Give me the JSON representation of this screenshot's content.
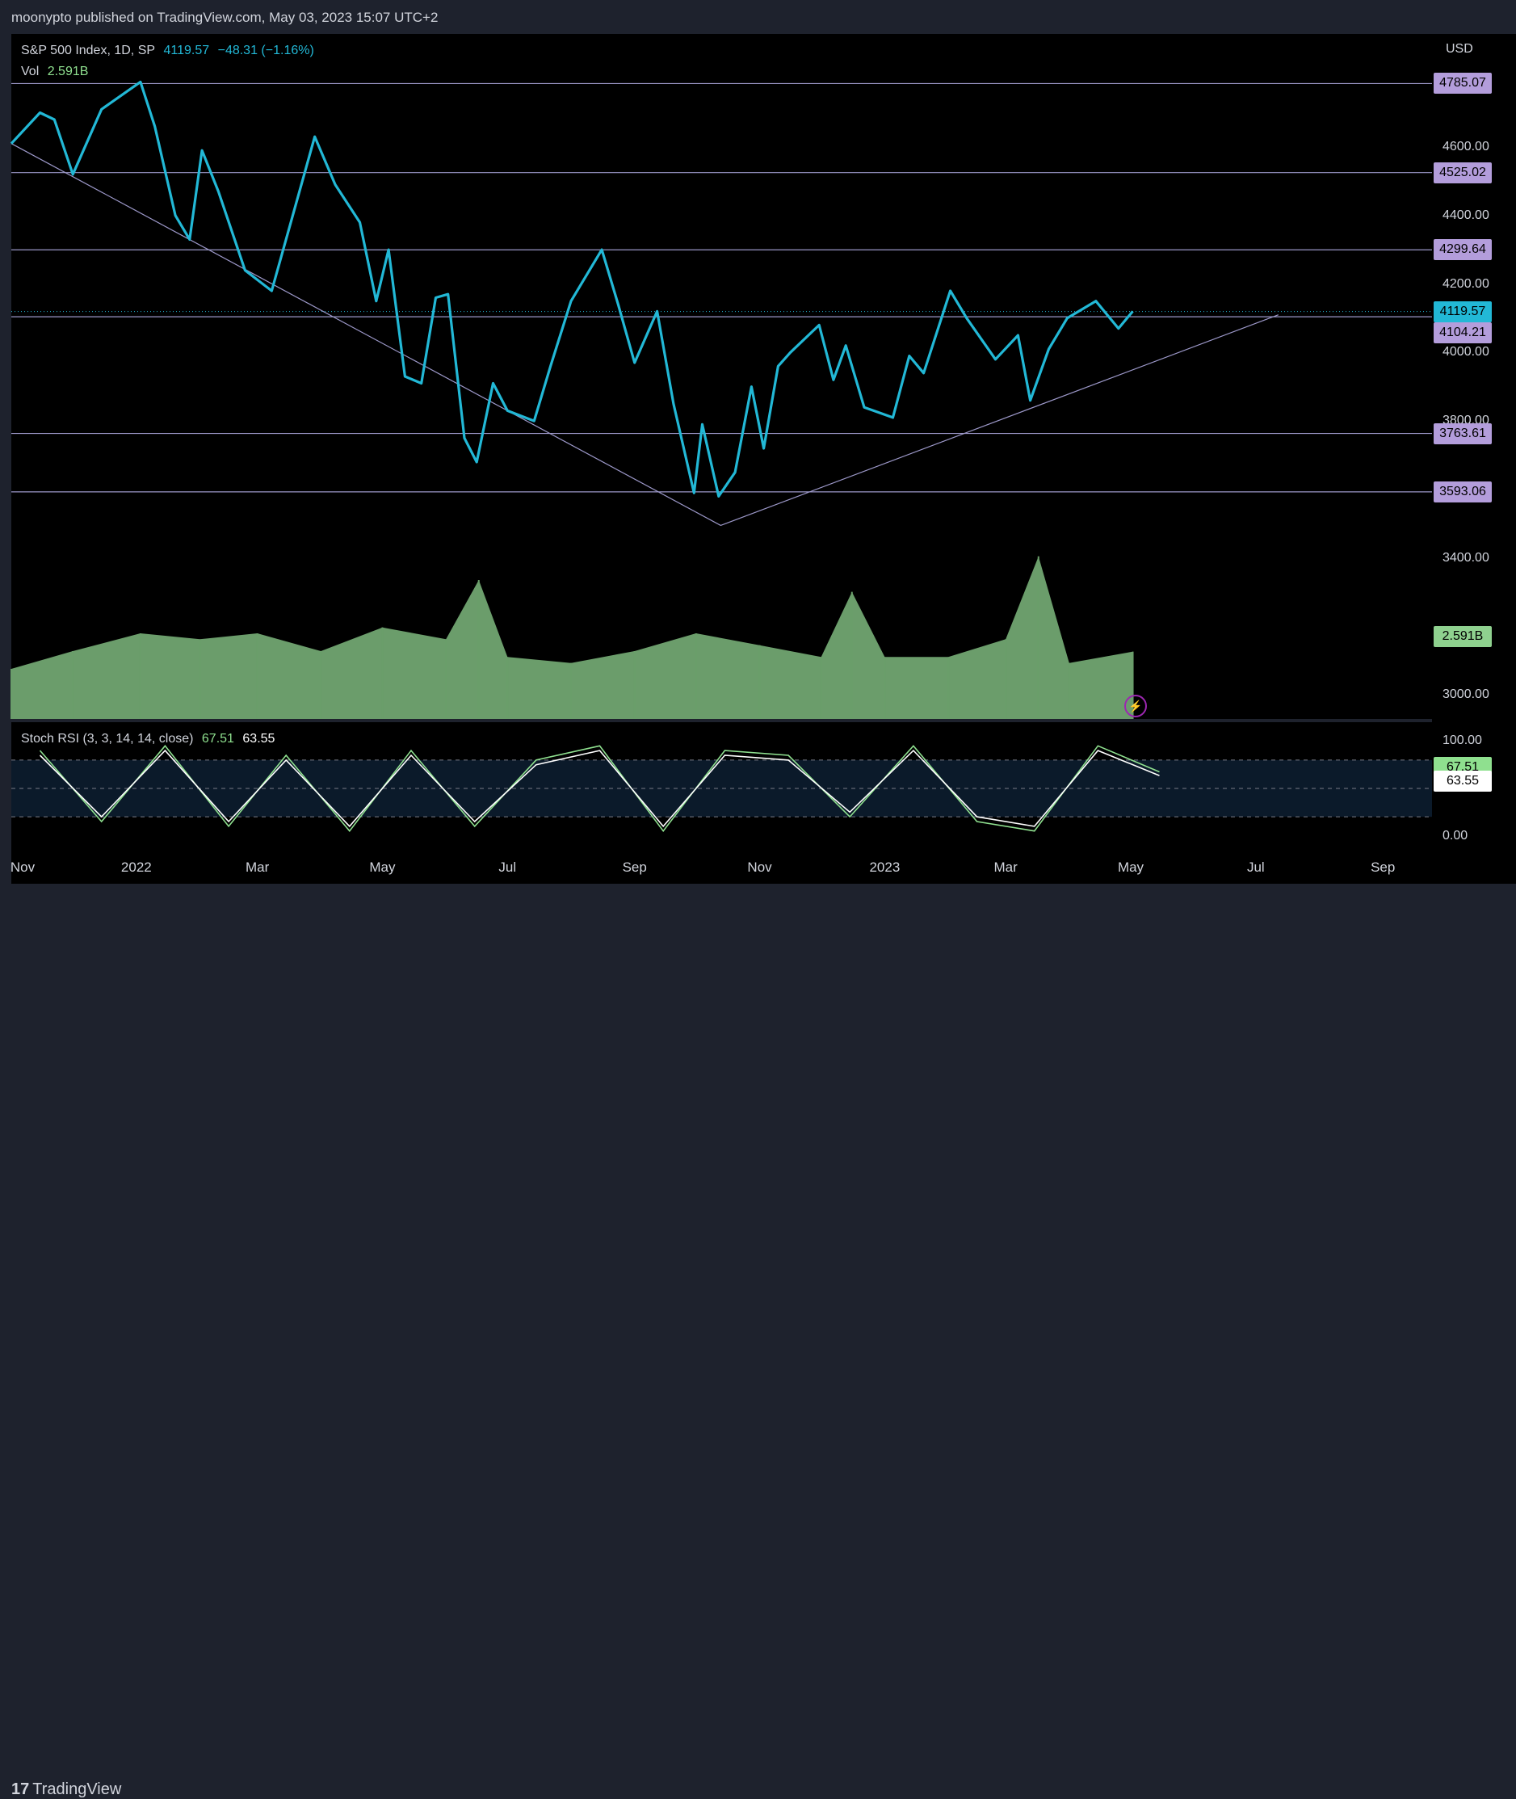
{
  "header": {
    "published_text": "moonypto published on TradingView.com, May 03, 2023 15:07 UTC+2"
  },
  "legend": {
    "symbol": "S&P 500 Index, 1D, SP",
    "last": "4119.57",
    "change": "−48.31 (−1.16%)",
    "vol_label": "Vol",
    "vol_value": "2.591B"
  },
  "stoch_legend": {
    "label": "Stoch RSI (3, 3, 14, 14, close)",
    "k": "67.51",
    "d": "63.55"
  },
  "axis": {
    "currency": "USD",
    "price_ticks": [
      "4600.00",
      "4400.00",
      "4200.00",
      "4000.00",
      "3800.00",
      "3400.00",
      "3000.00"
    ],
    "stoch_ticks": [
      "100.00",
      "0.00"
    ],
    "x_ticks": [
      "Nov",
      "2022",
      "Mar",
      "May",
      "Jul",
      "Sep",
      "Nov",
      "2023",
      "Mar",
      "May",
      "Jul",
      "Sep"
    ]
  },
  "tags": {
    "levels": [
      "4785.07",
      "4525.02",
      "4299.64",
      "4104.21",
      "3763.61",
      "3593.06"
    ],
    "last_price": "4119.57",
    "volume": "2.591B",
    "stoch_k": "67.51",
    "stoch_d": "63.55"
  },
  "footer": {
    "logo_text": "TradingView",
    "logo_mark": "17"
  },
  "colors": {
    "price_line": "#22b8d6",
    "level_tag": "#b39ddb",
    "volume": "#8fd18f",
    "stoch_k": "#8fe08f",
    "stoch_d": "#ffffff",
    "level_line": "#9c98c9"
  },
  "chart_data": [
    {
      "type": "line",
      "title": "S&P 500 Index, 1D, SP",
      "ylabel": "USD",
      "ylim": [
        2930,
        4930
      ],
      "x": [
        "2021-11-01",
        "2021-11-15",
        "2021-11-22",
        "2021-12-01",
        "2021-12-15",
        "2022-01-03",
        "2022-01-10",
        "2022-01-20",
        "2022-01-27",
        "2022-02-02",
        "2022-02-10",
        "2022-02-23",
        "2022-03-08",
        "2022-03-29",
        "2022-04-08",
        "2022-04-20",
        "2022-04-28",
        "2022-05-04",
        "2022-05-12",
        "2022-05-20",
        "2022-05-27",
        "2022-06-02",
        "2022-06-10",
        "2022-06-16",
        "2022-06-24",
        "2022-07-01",
        "2022-07-14",
        "2022-07-22",
        "2022-08-01",
        "2022-08-16",
        "2022-08-24",
        "2022-09-01",
        "2022-09-12",
        "2022-09-20",
        "2022-09-30",
        "2022-10-04",
        "2022-10-12",
        "2022-10-20",
        "2022-10-28",
        "2022-11-03",
        "2022-11-10",
        "2022-11-16",
        "2022-11-30",
        "2022-12-07",
        "2022-12-13",
        "2022-12-22",
        "2023-01-05",
        "2023-01-13",
        "2023-01-20",
        "2023-02-02",
        "2023-02-10",
        "2023-02-24",
        "2023-03-07",
        "2023-03-13",
        "2023-03-22",
        "2023-03-31",
        "2023-04-14",
        "2023-04-25",
        "2023-05-02"
      ],
      "series": [
        {
          "name": "",
          "values": [
            4610,
            4700,
            4680,
            4520,
            4710,
            4790,
            4660,
            4400,
            4330,
            4590,
            4470,
            4240,
            4180,
            4630,
            4490,
            4380,
            4150,
            4300,
            3930,
            3910,
            4160,
            4170,
            3750,
            3680,
            3910,
            3830,
            3800,
            3960,
            4150,
            4300,
            4140,
            3970,
            4120,
            3850,
            3590,
            3790,
            3580,
            3650,
            3900,
            3720,
            3960,
            4000,
            4080,
            3920,
            4020,
            3840,
            3810,
            3990,
            3940,
            4180,
            4100,
            3980,
            4050,
            3860,
            4010,
            4100,
            4150,
            4070,
            4120
          ]
        }
      ]
    },
    {
      "type": "area",
      "title": "Vol",
      "x": [
        "2021-11-01",
        "2021-12-01",
        "2022-01-03",
        "2022-02-01",
        "2022-03-01",
        "2022-04-01",
        "2022-05-01",
        "2022-06-01",
        "2022-06-17",
        "2022-07-01",
        "2022-08-01",
        "2022-09-01",
        "2022-10-01",
        "2022-11-01",
        "2022-12-01",
        "2022-12-16",
        "2023-01-01",
        "2023-02-01",
        "2023-03-01",
        "2023-03-17",
        "2023-04-01",
        "2023-05-02"
      ],
      "series": [
        {
          "name": "",
          "values": [
            2.3,
            2.6,
            2.9,
            2.8,
            2.9,
            2.6,
            3.0,
            2.8,
            3.8,
            2.5,
            2.4,
            2.6,
            2.9,
            2.7,
            2.5,
            3.6,
            2.5,
            2.5,
            2.8,
            4.2,
            2.4,
            2.591
          ]
        }
      ]
    },
    {
      "type": "line",
      "title": "Stoch RSI (3, 3, 14, 14, close)",
      "ylim": [
        -20,
        120
      ],
      "x": [
        "2021-11",
        "2021-12",
        "2022-01",
        "2022-02",
        "2022-03",
        "2022-04",
        "2022-05",
        "2022-06",
        "2022-07",
        "2022-08",
        "2022-09",
        "2022-10",
        "2022-11",
        "2022-12",
        "2023-01",
        "2023-02",
        "2023-03",
        "2023-04",
        "2023-05"
      ],
      "series": [
        {
          "name": "",
          "values": [
            90,
            15,
            95,
            10,
            85,
            5,
            90,
            10,
            80,
            95,
            5,
            90,
            85,
            20,
            95,
            15,
            5,
            95,
            67.51
          ]
        },
        {
          "name": "",
          "values": [
            85,
            20,
            90,
            15,
            80,
            10,
            85,
            15,
            75,
            90,
            10,
            85,
            80,
            25,
            90,
            20,
            10,
            90,
            63.55
          ]
        }
      ]
    }
  ]
}
